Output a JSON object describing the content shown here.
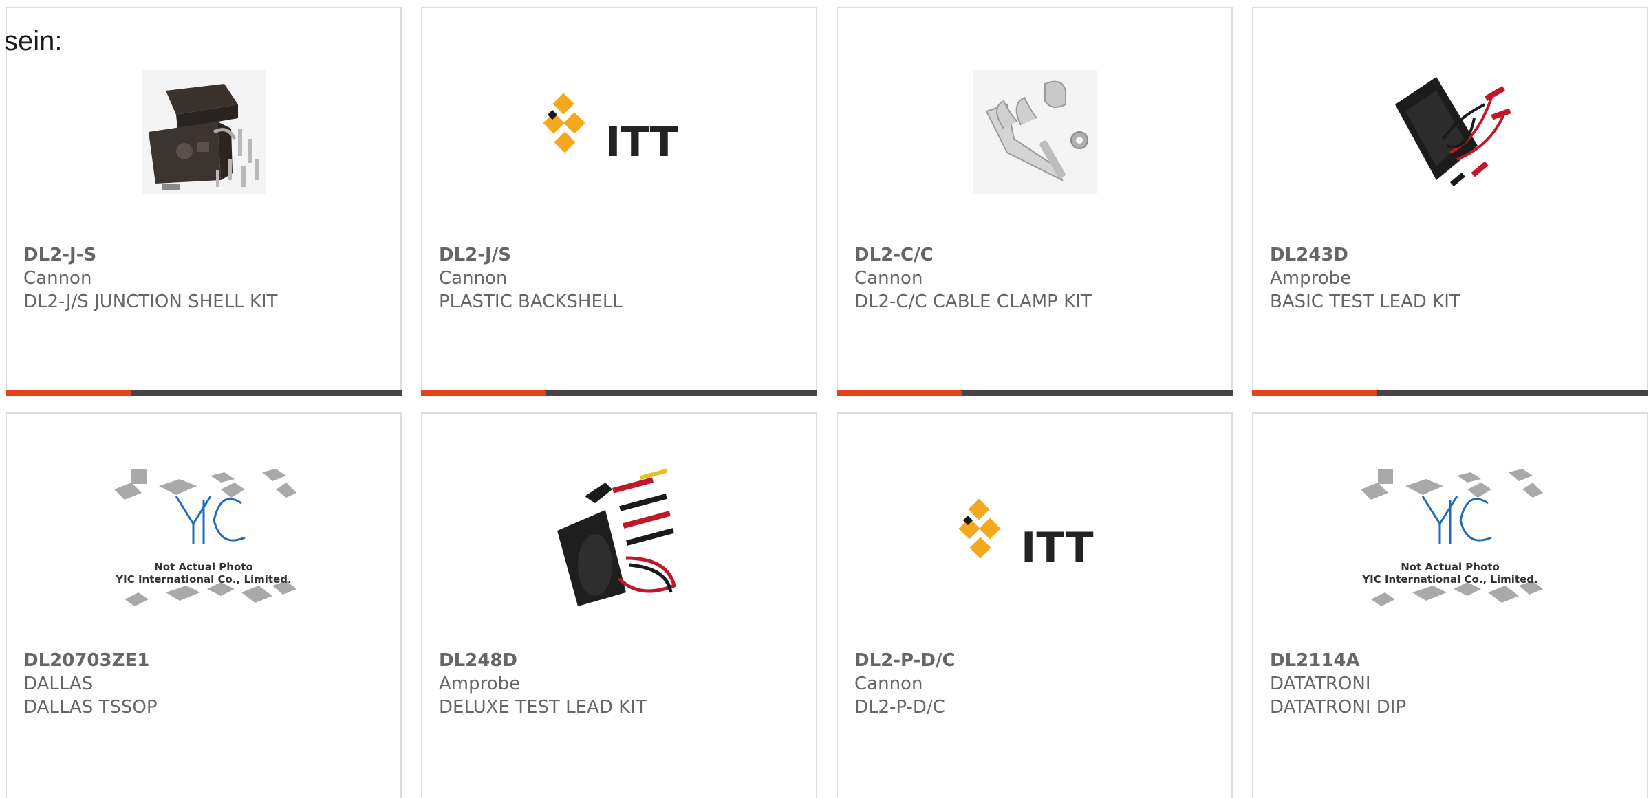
{
  "leadin": "sein:",
  "colors": {
    "accent": "#e8401c",
    "bar": "#444444",
    "text": "#666666",
    "border": "#dddddd",
    "itt_yellow": "#f3a81d"
  },
  "cards": [
    {
      "part": "DL2-J-S",
      "brand": "Cannon",
      "desc": "DL2-J/S JUNCTION SHELL KIT",
      "image": "junction-shell-kit-photo"
    },
    {
      "part": "DL2-J/S",
      "brand": "Cannon",
      "desc": "PLASTIC BACKSHELL",
      "image": "itt-logo",
      "logo_text": "ITT"
    },
    {
      "part": "DL2-C/C",
      "brand": "Cannon",
      "desc": "DL2-C/C CABLE CLAMP KIT",
      "image": "cable-clamp-kit-photo"
    },
    {
      "part": "DL243D",
      "brand": "Amprobe",
      "desc": "BASIC TEST LEAD KIT",
      "image": "test-lead-kit-photo"
    },
    {
      "part": "DL20703ZE1",
      "brand": "DALLAS",
      "desc": "DALLAS TSSOP",
      "image": "yic-placeholder",
      "placeholder_line1": "Not Actual Photo",
      "placeholder_line2": "YIC International Co., Limited."
    },
    {
      "part": "DL248D",
      "brand": "Amprobe",
      "desc": "DELUXE TEST LEAD KIT",
      "image": "deluxe-test-lead-kit-photo"
    },
    {
      "part": "DL2-P-D/C",
      "brand": "Cannon",
      "desc": "DL2-P-D/C",
      "image": "itt-logo",
      "logo_text": "ITT"
    },
    {
      "part": "DL2114A",
      "brand": "DATATRONI",
      "desc": "DATATRONI DIP",
      "image": "yic-placeholder",
      "placeholder_line1": "Not Actual Photo",
      "placeholder_line2": "YIC International Co., Limited."
    }
  ]
}
